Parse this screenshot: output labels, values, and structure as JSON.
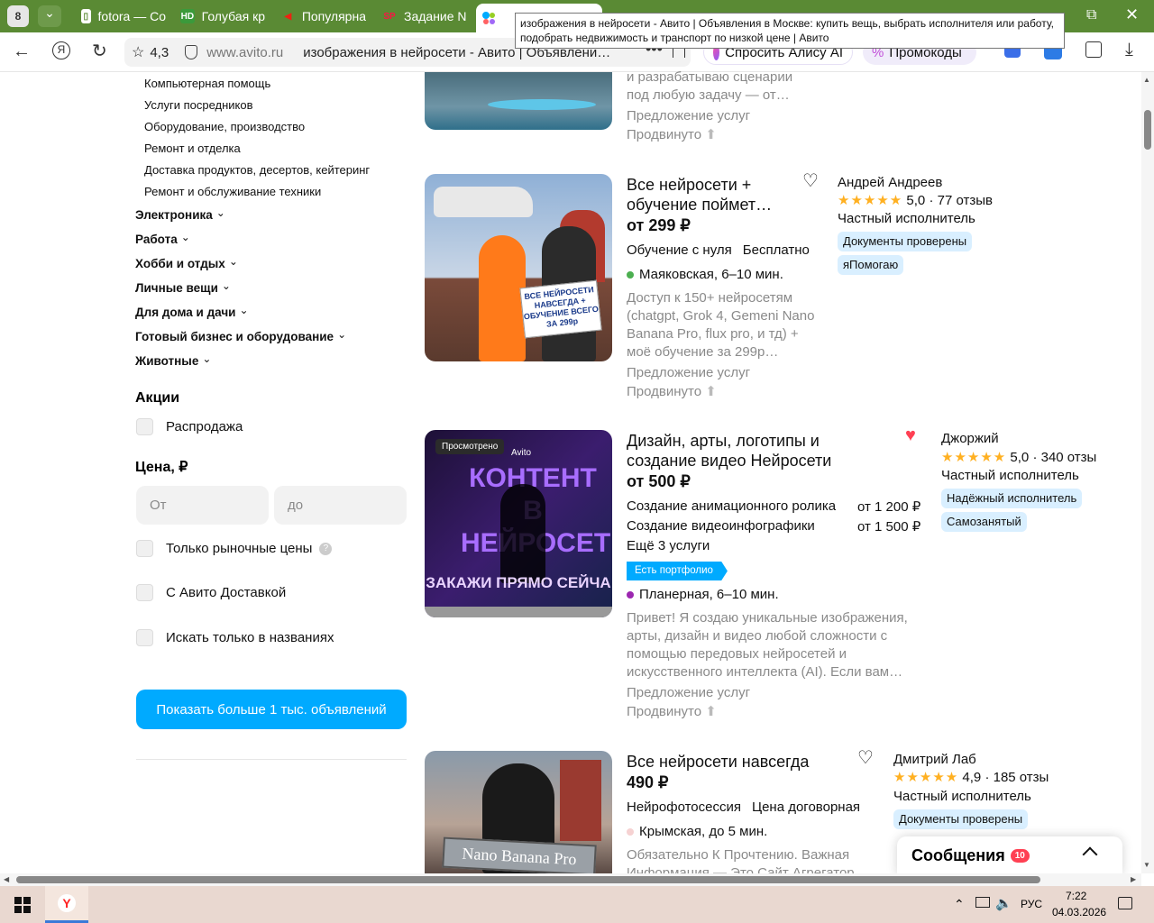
{
  "browser": {
    "tab_counter": "8",
    "tabs": [
      {
        "label": "fotora — Co",
        "fav": "F"
      },
      {
        "label": "Голубая кр",
        "fav": "HD"
      },
      {
        "label": "Популярна",
        "fav": "◀"
      },
      {
        "label": "Задание N",
        "fav": "SP"
      }
    ],
    "rating": "4,3",
    "url": "www.avito.ru",
    "page_title": "изображения в нейросети - Авито | Объявлени…",
    "ask_alice": "Спросить Алису AI",
    "promocodes": "Промокоды",
    "tooltip": "изображения в нейросети - Авито | Объявления в Москве: купить вещь, выбрать исполнителя или работу, подобрать недвижимость и транспорт по низкой цене | Авито"
  },
  "sidebar": {
    "subcategories": [
      "Компьютерная помощь",
      "Услуги посредников",
      "Оборудование, производство",
      "Ремонт и отделка",
      "Доставка продуктов, десертов, кейтеринг",
      "Ремонт и обслуживание техники"
    ],
    "categories": [
      "Электроника",
      "Работа",
      "Хобби и отдых",
      "Личные вещи",
      "Для дома и дачи",
      "Готовый бизнес и оборудование",
      "Животные"
    ],
    "promo_heading": "Акции",
    "sale_label": "Распродажа",
    "price_heading": "Цена, ₽",
    "price_from_ph": "От",
    "price_to_ph": "до",
    "market_price_label": "Только рыночные цены",
    "delivery_label": "С Авито Доставкой",
    "title_only_label": "Искать только в названиях",
    "show_more": "Показать больше 1 тыс. объявлений"
  },
  "listing0": {
    "desc": "и разрабатываю сценарии под любую задачу — от…",
    "type": "Предложение услуг",
    "promoted": "Продвинуто"
  },
  "listing1": {
    "title": "Все нейросети + обучение поймет…",
    "price": "от 299 ₽",
    "param1": "Обучение с нуля",
    "param2": "Бесплатно",
    "metro": "Маяковская, 6–10 мин.",
    "metro_color": "#4caf50",
    "desc": "Доступ к 150+ нейросетям (chatgpt, Grok 4, Gemeni Nano Banana Pro, flux pro, и тд) + моё обучение за 299р…",
    "type": "Предложение услуг",
    "promoted": "Продвинуто",
    "seller": "Андрей Андреев",
    "rating": "5,0 · 77 отзыв",
    "seller_type": "Частный исполнитель",
    "badges": [
      "Документы проверены",
      "яПомогаю"
    ],
    "img_sign": "ВСЕ НЕЙРОСЕТИ НАВСЕГДА + ОБУЧЕНИЕ ВСЕГО ЗА 299р"
  },
  "listing2": {
    "title": "Дизайн, арты, логотипы и создание видео Нейросети",
    "price": "от 500 ₽",
    "svc1": "Создание анимационного ролика",
    "svc1_price": "от 1 200 ₽",
    "svc2": "Создание видеоинфографики",
    "svc2_price": "от 1 500 ₽",
    "more": "Ещё 3 услуги",
    "portfolio": "Есть портфолио",
    "metro": "Планерная, 6–10 мин.",
    "metro_color": "#9c27b0",
    "desc": "Привет! Я создаю уникальные изображения, арты, дизайн и видео любой сложности с помощью передовых нейросетей и искусственного интеллекта (AI). Если вам…",
    "type": "Предложение услуг",
    "promoted": "Продвинуто",
    "seller": "Джоржий",
    "rating": "5,0 · 340 отзы",
    "seller_type": "Частный исполнитель",
    "badges": [
      "Надёжный исполнитель",
      "Самозанятый"
    ],
    "img_viewed": "Просмотрено",
    "img_avito": "Avito",
    "img_big": "КОНТЕНТ В НЕЙРОСЕТИ",
    "img_bottom": "ЗАКАЖИ ПРЯМО СЕЙЧА"
  },
  "listing3": {
    "title": "Все нейросети навсегда",
    "price": "490 ₽",
    "param1": "Нейрофотосессия",
    "param2": "Цена договорная",
    "metro": "Крымская, до 5 мин.",
    "metro_color": "#f6d2d2",
    "desc": "Обязательно К Прочтению. Важная Информация — Это Сайт Агрегатор…",
    "seller": "Дмитрий Лаб",
    "rating": "4,9 · 185 отзы",
    "seller_type": "Частный исполнитель",
    "badges": [
      "Документы проверены"
    ],
    "img_sign": "Nano Banana Pro"
  },
  "messages": {
    "label": "Сообщения",
    "count": "10"
  },
  "taskbar": {
    "lang": "РУС",
    "time": "7:22",
    "date": "04.03.2026"
  }
}
